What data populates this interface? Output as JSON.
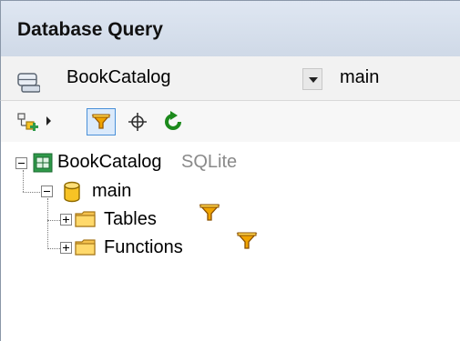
{
  "window": {
    "title": "Database Query"
  },
  "connection": {
    "datasource_icon": "database-connection-icon",
    "selected_datasource": "BookCatalog",
    "dropdown_icon": "chevron-down-icon",
    "selected_schema": "main"
  },
  "toolbar": {
    "items": [
      {
        "name": "add-datasource-button",
        "icon": "add-datasource-icon",
        "interactable": true
      },
      {
        "name": "add-datasource-menu-arrow",
        "icon": "caret-right-icon",
        "interactable": true
      },
      {
        "name": "filter-button",
        "icon": "filter-icon",
        "state": "active",
        "interactable": true
      },
      {
        "name": "locate-button",
        "icon": "crosshair-icon",
        "interactable": true
      },
      {
        "name": "refresh-button",
        "icon": "refresh-icon",
        "color": "#1c8a1c",
        "interactable": true
      }
    ]
  },
  "tree": {
    "root": {
      "label": "BookCatalog",
      "type_label": "SQLite",
      "expanded": true,
      "icon": "database-root-icon"
    },
    "schema": {
      "label": "main",
      "expanded": true,
      "icon": "cylinder-icon"
    },
    "folders": [
      {
        "label": "Tables",
        "expanded": false,
        "icon": "folder-icon",
        "filter_icon": "filter-icon"
      },
      {
        "label": "Functions",
        "expanded": false,
        "icon": "folder-icon",
        "filter_icon": "filter-icon"
      }
    ]
  },
  "colors": {
    "titlebar": "#dfe7f2",
    "filter_accent": "#e89a00",
    "folder": "#f5c24d",
    "cylinder": "#f7c325",
    "refresh": "#1c8a1c",
    "root_icon": "#2f9a4a",
    "active_button_border": "#4a90d9"
  }
}
